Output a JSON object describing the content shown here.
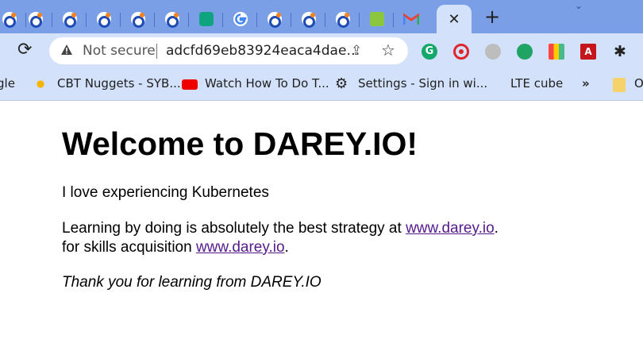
{
  "browser": {
    "active_tab_close": "✕",
    "new_tab": "+",
    "tab_search_icon": "chevron-down-icon",
    "omnibox": {
      "security_label": "Not secure",
      "url": "adcfd69eb83924eaca4dae…"
    },
    "bookmarks": [
      {
        "label": "gle"
      },
      {
        "label": "CBT Nuggets - SYB..."
      },
      {
        "label": "Watch How To Do T..."
      },
      {
        "label": "Settings - Sign in wi..."
      },
      {
        "label": "LTE cube"
      },
      {
        "label": "»"
      },
      {
        "label": "O"
      }
    ]
  },
  "page": {
    "heading": "Welcome to DAREY.IO!",
    "line1": "I love experiencing Kubernetes",
    "line2_text": "Learning by doing is absolutely the best strategy at ",
    "line2_link": "www.darey.io",
    "line2_end": ".",
    "line3_text": "for skills acquisition ",
    "line3_link": "www.darey.io",
    "line3_end": ".",
    "thanks": "Thank you for learning from DAREY.IO"
  },
  "colors": {
    "tabstrip": "#7b9fe6",
    "toolbar": "#d3e1fb",
    "link_visited": "#551a8b"
  }
}
